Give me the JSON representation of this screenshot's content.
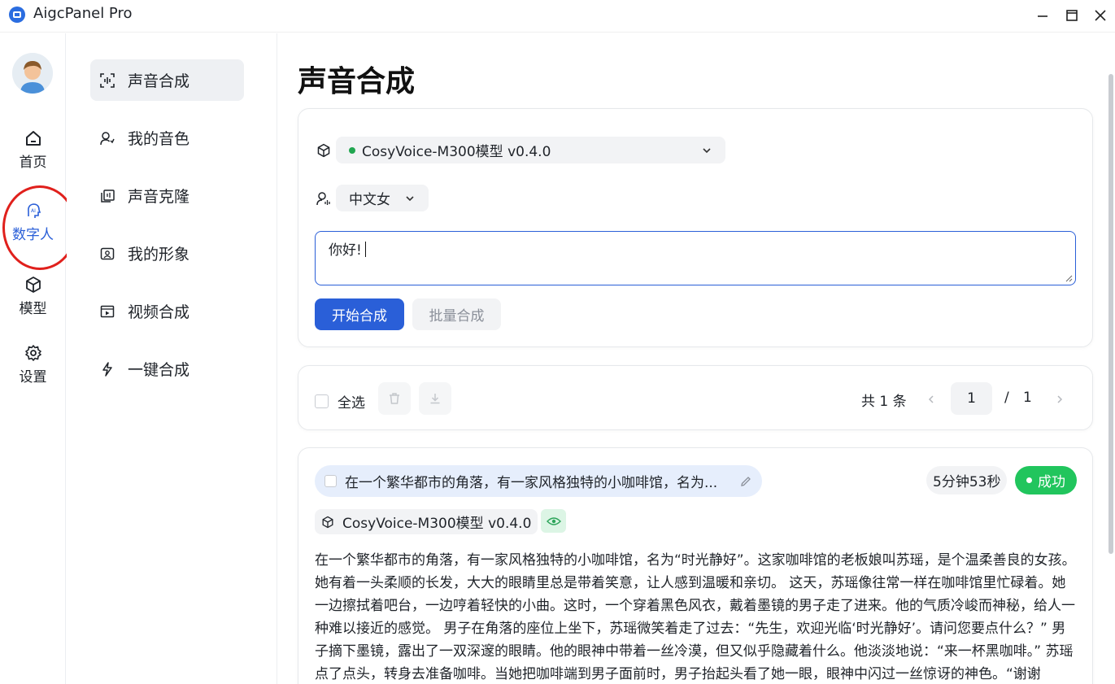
{
  "app": {
    "title": "AigcPanel Pro",
    "window_controls": [
      "minimize-icon",
      "maximize-icon",
      "close-icon"
    ]
  },
  "leftnav": {
    "items": [
      {
        "label": "首页",
        "icon": "home-icon"
      },
      {
        "label": "数字人",
        "icon": "ai-head-icon",
        "active": true
      },
      {
        "label": "模型",
        "icon": "cube-icon"
      },
      {
        "label": "设置",
        "icon": "gear-icon"
      }
    ]
  },
  "subnav": {
    "items": [
      {
        "label": "声音合成",
        "icon": "scan-voice-icon",
        "active": true
      },
      {
        "label": "我的音色",
        "icon": "user-voice-icon"
      },
      {
        "label": "声音克隆",
        "icon": "clone-icon"
      },
      {
        "label": "我的形象",
        "icon": "avatar-frame-icon"
      },
      {
        "label": "视频合成",
        "icon": "video-icon"
      },
      {
        "label": "一键合成",
        "icon": "lightning-icon"
      }
    ]
  },
  "main": {
    "title": "声音合成",
    "form": {
      "model_select": "CosyVoice-M300模型 v0.4.0",
      "voice_select": "中文女",
      "text_input": "你好!",
      "start_button": "开始合成",
      "batch_button": "批量合成"
    },
    "toolbar": {
      "select_all": "全选",
      "total": "共 1 条",
      "current_page": "1",
      "page_sep": "/",
      "total_pages": "1"
    },
    "task": {
      "title": "在一个繁华都市的角落，有一家风格独特的小咖啡馆，名为...",
      "duration": "5分钟53秒",
      "status": "成功",
      "model": "CosyVoice-M300模型 v0.4.0",
      "text": "在一个繁华都市的角落，有一家风格独特的小咖啡馆，名为“时光静好”。这家咖啡馆的老板娘叫苏瑶，是个温柔善良的女孩。她有着一头柔顺的长发，大大的眼睛里总是带着笑意，让人感到温暖和亲切。 这天，苏瑶像往常一样在咖啡馆里忙碌着。她一边擦拭着吧台，一边哼着轻快的小曲。这时，一个穿着黑色风衣，戴着墨镜的男子走了进来。他的气质冷峻而神秘，给人一种难以接近的感觉。 男子在角落的座位上坐下，苏瑶微笑着走了过去：“先生，欢迎光临‘时光静好’。请问您要点什么？” 男子摘下墨镜，露出了一双深邃的眼睛。他的眼神中带着一丝冷漠，但又似乎隐藏着什么。他淡淡地说：“来一杯黑咖啡。” 苏瑶点了点头，转身去准备咖啡。当她把咖啡端到男子面前时，男子抬起头看了她一眼，眼神中闪过一丝惊讶的神色。“谢谢你。”男子接过咖啡后淡淡地说。“不客气。”苏瑶微笑着回答，然后转身离开，他却叫住了她。"
    }
  },
  "colors": {
    "accent": "#2a5fd8",
    "success": "#21c55d",
    "annotation": "#e0201c"
  }
}
